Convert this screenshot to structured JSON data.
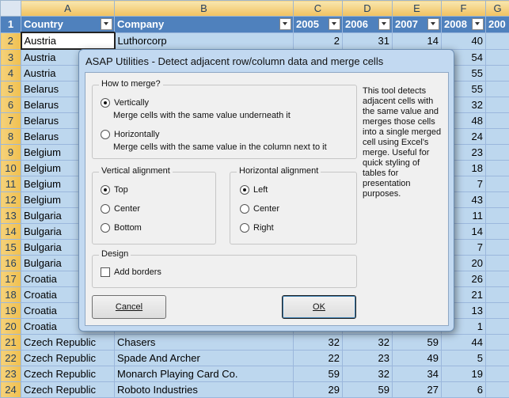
{
  "sheet": {
    "columns": [
      "A",
      "B",
      "C",
      "D",
      "E",
      "F",
      "G"
    ],
    "header": [
      "Country",
      "Company",
      "2005",
      "2006",
      "2007",
      "2008",
      "200"
    ],
    "rows": [
      [
        "Austria",
        "Luthorcorp",
        "2",
        "31",
        "14",
        "40"
      ],
      [
        "Austria",
        "",
        "",
        "",
        "",
        "54"
      ],
      [
        "Austria",
        "",
        "",
        "",
        "",
        "55"
      ],
      [
        "Belarus",
        "",
        "",
        "",
        "",
        "55"
      ],
      [
        "Belarus",
        "",
        "",
        "",
        "",
        "32"
      ],
      [
        "Belarus",
        "",
        "",
        "",
        "",
        "48"
      ],
      [
        "Belarus",
        "",
        "",
        "",
        "",
        "24"
      ],
      [
        "Belgium",
        "",
        "",
        "",
        "",
        "23"
      ],
      [
        "Belgium",
        "",
        "",
        "",
        "",
        "18"
      ],
      [
        "Belgium",
        "",
        "",
        "",
        "",
        "7"
      ],
      [
        "Belgium",
        "",
        "",
        "",
        "",
        "43"
      ],
      [
        "Bulgaria",
        "",
        "",
        "",
        "",
        "11"
      ],
      [
        "Bulgaria",
        "",
        "",
        "",
        "",
        "14"
      ],
      [
        "Bulgaria",
        "",
        "",
        "",
        "",
        "7"
      ],
      [
        "Bulgaria",
        "",
        "",
        "",
        "",
        "20"
      ],
      [
        "Croatia",
        "",
        "",
        "",
        "",
        "26"
      ],
      [
        "Croatia",
        "",
        "",
        "",
        "",
        "21"
      ],
      [
        "Croatia",
        "",
        "",
        "",
        "",
        "13"
      ],
      [
        "Croatia",
        "",
        "",
        "",
        "",
        "1"
      ],
      [
        "Czech Republic",
        "Chasers",
        "32",
        "32",
        "59",
        "44"
      ],
      [
        "Czech Republic",
        "Spade And Archer",
        "22",
        "23",
        "49",
        "5"
      ],
      [
        "Czech Republic",
        "Monarch Playing Card Co.",
        "59",
        "32",
        "34",
        "19"
      ],
      [
        "Czech Republic",
        "Roboto Industries",
        "29",
        "59",
        "27",
        "6"
      ]
    ]
  },
  "dialog": {
    "title": "ASAP Utilities - Detect adjacent row/column data and merge cells",
    "how_to_merge": {
      "legend": "How to merge?",
      "vertically_label": "Vertically",
      "vertically_desc": "Merge cells with the same value underneath it",
      "horizontally_label": "Horizontally",
      "horizontally_desc": "Merge cells with the same value in the column next to it",
      "selected": "Vertically"
    },
    "vertical_alignment": {
      "legend": "Vertical alignment",
      "options": [
        "Top",
        "Center",
        "Bottom"
      ],
      "selected": "Top"
    },
    "horizontal_alignment": {
      "legend": "Horizontal alignment",
      "options": [
        "Left",
        "Center",
        "Right"
      ],
      "selected": "Left"
    },
    "design": {
      "legend": "Design",
      "add_borders_label": "Add borders",
      "add_borders_checked": false
    },
    "info_text": "This tool detects adjacent cells with the same value and merges those cells into a single merged cell using Excel's merge. Useful for quick styling of tables for presentation purposes.",
    "cancel_label": "Cancel",
    "ok_label": "OK"
  },
  "colors": {
    "header_fill": "#4f81bd",
    "cell_fill": "#bdd7ee",
    "row_header_fill": "#f0c050",
    "dialog_frame": "#c2d9f1"
  }
}
